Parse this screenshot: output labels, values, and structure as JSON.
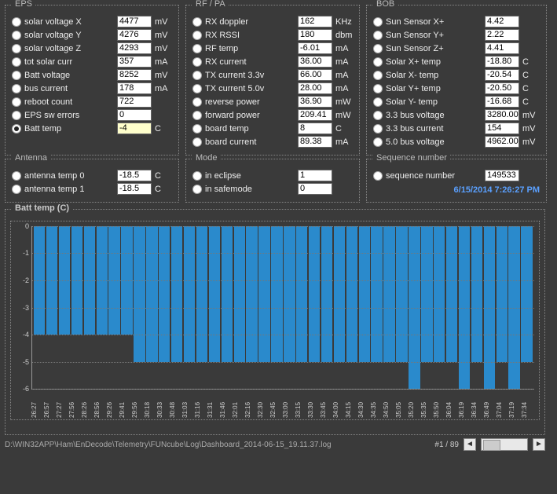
{
  "panels": {
    "eps": {
      "title": "EPS",
      "rows": [
        {
          "name": "solar-voltage-x",
          "label": "solar voltage X",
          "value": "4477",
          "unit": "mV",
          "selected": false
        },
        {
          "name": "solar-voltage-y",
          "label": "solar voltage Y",
          "value": "4276",
          "unit": "mV",
          "selected": false
        },
        {
          "name": "solar-voltage-z",
          "label": "solar voltage Z",
          "value": "4293",
          "unit": "mV",
          "selected": false
        },
        {
          "name": "tot-solar-curr",
          "label": "tot solar curr",
          "value": "357",
          "unit": "mA",
          "selected": false
        },
        {
          "name": "batt-voltage",
          "label": "Batt voltage",
          "value": "8252",
          "unit": "mV",
          "selected": false
        },
        {
          "name": "bus-current",
          "label": "bus current",
          "value": "178",
          "unit": "mA",
          "selected": false
        },
        {
          "name": "reboot-count",
          "label": "reboot count",
          "value": "722",
          "unit": "",
          "selected": false
        },
        {
          "name": "eps-sw-errors",
          "label": "EPS sw errors",
          "value": "0",
          "unit": "",
          "selected": false
        },
        {
          "name": "batt-temp",
          "label": "Batt temp",
          "value": "-4",
          "unit": "C",
          "selected": true
        }
      ]
    },
    "rfpa": {
      "title": "RF / PA",
      "rows": [
        {
          "name": "rx-doppler",
          "label": "RX doppler",
          "value": "162",
          "unit": "KHz",
          "selected": false
        },
        {
          "name": "rx-rssi",
          "label": "RX RSSI",
          "value": "180",
          "unit": "dbm",
          "selected": false
        },
        {
          "name": "rf-temp",
          "label": "RF temp",
          "value": "-6.01",
          "unit": "mA",
          "selected": false
        },
        {
          "name": "rx-current",
          "label": "RX current",
          "value": "36.00",
          "unit": "mA",
          "selected": false
        },
        {
          "name": "tx-current-33v",
          "label": "TX current 3.3v",
          "value": "66.00",
          "unit": "mA",
          "selected": false
        },
        {
          "name": "tx-current-50v",
          "label": "TX current 5.0v",
          "value": "28.00",
          "unit": "mA",
          "selected": false
        },
        {
          "name": "reverse-power",
          "label": "reverse power",
          "value": "36.90",
          "unit": "mW",
          "selected": false
        },
        {
          "name": "forward-power",
          "label": "forward power",
          "value": "209.41",
          "unit": "mW",
          "selected": false
        },
        {
          "name": "board-temp",
          "label": "board temp",
          "value": "8",
          "unit": "C",
          "selected": false
        },
        {
          "name": "board-current",
          "label": "board current",
          "value": "89.38",
          "unit": "mA",
          "selected": false
        }
      ]
    },
    "bob": {
      "title": "BOB",
      "rows": [
        {
          "name": "sun-sensor-x",
          "label": "Sun Sensor X+",
          "value": "4.42",
          "unit": "",
          "selected": false
        },
        {
          "name": "sun-sensor-y",
          "label": "Sun Sensor Y+",
          "value": "2.22",
          "unit": "",
          "selected": false
        },
        {
          "name": "sun-sensor-z",
          "label": "Sun Sensor Z+",
          "value": "4.41",
          "unit": "",
          "selected": false
        },
        {
          "name": "solar-xp-temp",
          "label": "Solar X+ temp",
          "value": "-18.80",
          "unit": "C",
          "selected": false
        },
        {
          "name": "solar-xm-temp",
          "label": "Solar X- temp",
          "value": "-20.54",
          "unit": "C",
          "selected": false
        },
        {
          "name": "solar-yp-temp",
          "label": "Solar Y+ temp",
          "value": "-20.50",
          "unit": "C",
          "selected": false
        },
        {
          "name": "solar-ym-temp",
          "label": "Solar Y- temp",
          "value": "-16.68",
          "unit": "C",
          "selected": false
        },
        {
          "name": "bus-33-voltage",
          "label": "3.3 bus voltage",
          "value": "3280.00",
          "unit": "mV",
          "selected": false
        },
        {
          "name": "bus-33-current",
          "label": "3.3 bus current",
          "value": "154",
          "unit": "mV",
          "selected": false
        },
        {
          "name": "bus-50-voltage",
          "label": "5.0 bus voltage",
          "value": "4962.00",
          "unit": "mV",
          "selected": false
        }
      ]
    },
    "antenna": {
      "title": "Antenna",
      "rows": [
        {
          "name": "antenna-temp-0",
          "label": "antenna temp 0",
          "value": "-18.5",
          "unit": "C",
          "selected": false
        },
        {
          "name": "antenna-temp-1",
          "label": "antenna temp 1",
          "value": "-18.5",
          "unit": "C",
          "selected": false
        }
      ]
    },
    "mode": {
      "title": "Mode",
      "rows": [
        {
          "name": "in-eclipse",
          "label": "in eclipse",
          "value": "1",
          "unit": "",
          "selected": false
        },
        {
          "name": "in-safemode",
          "label": "in safemode",
          "value": "0",
          "unit": "",
          "selected": false
        }
      ]
    },
    "seq": {
      "title": "Sequence number",
      "rows": [
        {
          "name": "sequence-number",
          "label": "sequence number",
          "value": "149533",
          "unit": "",
          "selected": false
        }
      ],
      "timestamp": "6/15/2014 7:26:27 PM"
    }
  },
  "chart_data": {
    "type": "bar",
    "title": "Batt temp     (C)",
    "ylabel": "C",
    "ylim": [
      -6,
      0
    ],
    "yticks": [
      0,
      -1,
      -2,
      -3,
      -4,
      -5,
      -6
    ],
    "categories": [
      "26:27",
      "26:57",
      "27:27",
      "27:56",
      "28:26",
      "28:56",
      "29:26",
      "29:41",
      "29:56",
      "30:18",
      "30:33",
      "30:48",
      "31:03",
      "31:16",
      "31:31",
      "31:46",
      "32:01",
      "32:16",
      "32:30",
      "32:45",
      "33:00",
      "33:15",
      "33:30",
      "33:45",
      "34:00",
      "34:15",
      "34:30",
      "34:35",
      "34:50",
      "35:05",
      "35:20",
      "35:35",
      "35:50",
      "36:04",
      "36:19",
      "36:34",
      "36:49",
      "37:04",
      "37:19",
      "37:34"
    ],
    "values": [
      -4,
      -4,
      -4,
      -4,
      -4,
      -4,
      -4,
      -4,
      -5,
      -5,
      -5,
      -5,
      -5,
      -5,
      -5,
      -5,
      -5,
      -5,
      -5,
      -5,
      -5,
      -5,
      -5,
      -5,
      -5,
      -5,
      -5,
      -5,
      -5,
      -5,
      -6,
      -5,
      -5,
      -5,
      -6,
      -5,
      -6,
      -5,
      -6,
      -5
    ]
  },
  "status": {
    "path": "D:\\WIN32APP\\Ham\\EnDecode\\Telemetry\\FUNcube\\Log\\Dashboard_2014-06-15_19.11.37.log",
    "page": "#1 / 89",
    "prev": "◄",
    "next": "►"
  }
}
